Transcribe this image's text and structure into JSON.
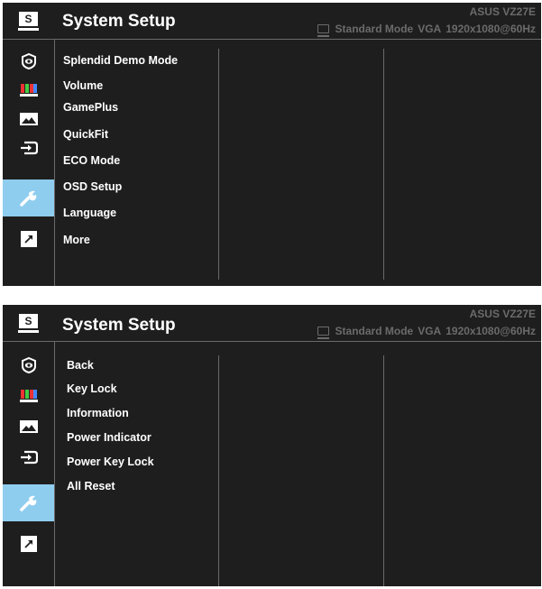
{
  "colors": {
    "panel_bg": "#1e1e1e",
    "active_bg": "#8fcdef",
    "header_gray": "#6b6b6b",
    "text": "#ffffff"
  },
  "panels": [
    {
      "logo": "S",
      "title": "System Setup",
      "model": "ASUS  VZ27E",
      "status": {
        "mode": "Standard Mode",
        "input": "VGA",
        "resolution": "1920x1080@60Hz"
      },
      "sidebar_icons": [
        "splendid-eye-icon",
        "color-bars-icon",
        "image-icon",
        "input-select-icon",
        "wrench-icon",
        "shortcut-arrow-icon"
      ],
      "active_sidebar": "wrench-icon",
      "menu": [
        "Splendid Demo Mode",
        "Volume",
        "GamePlus",
        "QuickFit",
        "ECO Mode",
        "OSD Setup",
        "Language",
        "More"
      ]
    },
    {
      "logo": "S",
      "title": "System Setup",
      "model": "ASUS  VZ27E",
      "status": {
        "mode": "Standard Mode",
        "input": "VGA",
        "resolution": "1920x1080@60Hz"
      },
      "sidebar_icons": [
        "splendid-eye-icon",
        "color-bars-icon",
        "image-icon",
        "input-select-icon",
        "wrench-icon",
        "shortcut-arrow-icon"
      ],
      "active_sidebar": "wrench-icon",
      "menu": [
        "Back",
        "Key Lock",
        "Information",
        "Power Indicator",
        "Power Key Lock",
        "All Reset"
      ]
    }
  ]
}
